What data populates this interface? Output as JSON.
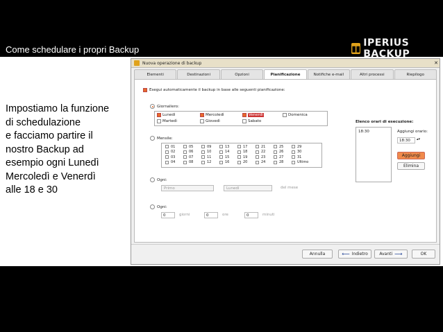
{
  "slide": {
    "title": "Come schedulare i propri Backup",
    "logo_text": "IPERIUS BACKUP",
    "description": "Impostiamo la funzione\ndi schedulazione\ne facciamo partire il\nnostro Backup  ad\nesempio ogni Lunedì\nMercoledì e Venerdì\nalle 18 e 30"
  },
  "window": {
    "title": "Nuova operazione di backup",
    "close": "✕",
    "tabs": [
      "Elementi",
      "Destinazioni",
      "Opzioni",
      "Pianificazione",
      "Notifiche e-mail",
      "Altri processi",
      "Riepilogo"
    ],
    "active_tab": "Pianificazione",
    "enable_label": "Esegui automaticamente il backup in base alle seguenti pianificazione:",
    "weekly_label": "Giornaliero:",
    "days": [
      {
        "label": "Lunedì",
        "checked": true
      },
      {
        "label": "Mercoledì",
        "checked": true
      },
      {
        "label": "Venerdì",
        "checked": true
      },
      {
        "label": "Domenica",
        "checked": false
      },
      {
        "label": "Martedì",
        "checked": false
      },
      {
        "label": "Giovedì",
        "checked": false
      },
      {
        "label": "Sabato",
        "checked": false
      }
    ],
    "monthly_label": "Mensile:",
    "month_days": [
      "01",
      "02",
      "03",
      "04",
      "05",
      "06",
      "07",
      "08",
      "09",
      "10",
      "11",
      "12",
      "13",
      "14",
      "15",
      "16",
      "17",
      "18",
      "19",
      "20",
      "21",
      "22",
      "23",
      "24",
      "25",
      "26",
      "27",
      "28",
      "29",
      "30",
      "31",
      "Ultimo"
    ],
    "every_label": "Ogni:",
    "every_first": "Primo",
    "every_day": "Lunedì",
    "of_month": "del mese",
    "every2_label": "Ogni:",
    "interval_days_value": "0",
    "interval_days_unit": "giorni",
    "interval_hours_value": "0",
    "interval_hours_unit": "ore",
    "interval_min_value": "0",
    "interval_min_unit": "minuti",
    "times_label": "Elenco orari di esecuzione:",
    "times": [
      "18:30"
    ],
    "add_time_label": "Aggiungi orario:",
    "add_time_value": "18:30",
    "add_button": "Aggiungi",
    "delete_button": "Elimina",
    "cancel_button": "Annulla",
    "back_button": "Indietro",
    "next_button": "Avanti",
    "ok_button": "OK"
  }
}
